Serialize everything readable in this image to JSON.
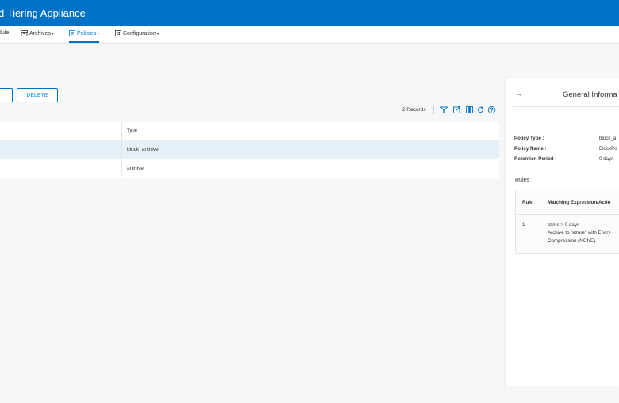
{
  "header": {
    "title": "d Tiering Appliance"
  },
  "nav": {
    "items": [
      {
        "label": "dule"
      },
      {
        "label": "Archives",
        "caret": "▾"
      },
      {
        "label": "Policies",
        "caret": "▾"
      },
      {
        "label": "Configuration",
        "caret": "▾"
      }
    ]
  },
  "toolbar": {
    "delete_label": "DELETE",
    "records": "2 Records"
  },
  "icons": [
    "filter-icon",
    "export-icon",
    "columns-icon",
    "refresh-icon",
    "help-icon"
  ],
  "grid": {
    "columns": [
      "Type"
    ],
    "rows": [
      {
        "type": "block_archive",
        "selected": true
      },
      {
        "type": "archive",
        "selected": false
      }
    ]
  },
  "panel": {
    "arrow": "→",
    "title": "General Informa",
    "fields": [
      {
        "label": "Policy Type :",
        "value": "block_a"
      },
      {
        "label": "Policy Name :",
        "value": "BlockPo"
      },
      {
        "label": "Retention Period :",
        "value": "0 days"
      }
    ],
    "rules_label": "Rules",
    "rules_headers": [
      "Rule",
      "Matching Expression/Actio"
    ],
    "rules": [
      {
        "rule": "1",
        "lines": [
          "ctime > 0 days",
          "Archive to \"azure\" with Encry",
          "Compression (NONE)"
        ]
      }
    ]
  },
  "colors": {
    "brand": "#0072c6",
    "selected_row": "#e6f0f9",
    "background": "#f6f7f8"
  }
}
